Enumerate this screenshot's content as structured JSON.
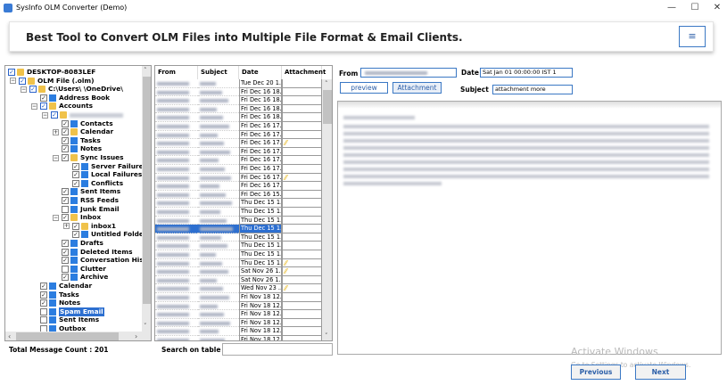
{
  "window": {
    "title": "SysInfo OLM Converter (Demo)",
    "min": "—",
    "max": "☐",
    "close": "✕"
  },
  "banner": {
    "heading": "Best Tool to Convert OLM Files into Multiple File Format & Email Clients.",
    "menu_icon": "≡"
  },
  "tree": {
    "items": [
      {
        "label": "DESKTOP-8083LEF",
        "level": 0,
        "checked": true,
        "blue": true,
        "icon": "folder",
        "exp": "-"
      },
      {
        "label": "OLM File (.olm)",
        "level": 1,
        "checked": true,
        "blue": true,
        "icon": "folder",
        "exp": "-"
      },
      {
        "label": "C:\\Users\\ \\OneDrive\\",
        "level": 2,
        "checked": true,
        "blue": true,
        "icon": "folder",
        "exp": "-"
      },
      {
        "label": "Address Book",
        "level": 3,
        "checked": true,
        "icon": "file"
      },
      {
        "label": "Accounts",
        "level": 3,
        "checked": true,
        "blue": true,
        "icon": "folder",
        "exp": "-"
      },
      {
        "label": "",
        "level": 4,
        "checked": true,
        "blue": true,
        "icon": "folder",
        "exp": "-",
        "blur": true
      },
      {
        "label": "Contacts",
        "level": 5,
        "checked": true,
        "icon": "file"
      },
      {
        "label": "Calendar",
        "level": 5,
        "checked": true,
        "icon": "folder",
        "exp": "+"
      },
      {
        "label": "Tasks",
        "level": 5,
        "checked": true,
        "icon": "file"
      },
      {
        "label": "Notes",
        "level": 5,
        "checked": true,
        "icon": "file"
      },
      {
        "label": "Sync Issues",
        "level": 5,
        "checked": true,
        "icon": "folder",
        "exp": "-"
      },
      {
        "label": "Server Failures",
        "level": 6,
        "checked": true,
        "icon": "file"
      },
      {
        "label": "Local Failures",
        "level": 6,
        "checked": true,
        "icon": "file"
      },
      {
        "label": "Conflicts",
        "level": 6,
        "checked": true,
        "icon": "file"
      },
      {
        "label": "Sent Items",
        "level": 5,
        "checked": true,
        "icon": "file"
      },
      {
        "label": "RSS Feeds",
        "level": 5,
        "checked": true,
        "icon": "file"
      },
      {
        "label": "Junk Email",
        "level": 5,
        "checked": false,
        "icon": "file"
      },
      {
        "label": "Inbox",
        "level": 5,
        "checked": true,
        "icon": "folder",
        "exp": "-"
      },
      {
        "label": "inbox1",
        "level": 6,
        "checked": true,
        "icon": "folder",
        "exp": "+"
      },
      {
        "label": "Untitled Folder",
        "level": 6,
        "checked": true,
        "icon": "file"
      },
      {
        "label": "Drafts",
        "level": 5,
        "checked": true,
        "icon": "file"
      },
      {
        "label": "Deleted Items",
        "level": 5,
        "checked": true,
        "icon": "file"
      },
      {
        "label": "Conversation Histo",
        "level": 5,
        "checked": true,
        "icon": "file"
      },
      {
        "label": "Clutter",
        "level": 5,
        "checked": false,
        "icon": "file"
      },
      {
        "label": "Archive",
        "level": 5,
        "checked": true,
        "icon": "file"
      },
      {
        "label": "Calendar",
        "level": 3,
        "checked": true,
        "icon": "file"
      },
      {
        "label": "Tasks",
        "level": 3,
        "checked": true,
        "icon": "file"
      },
      {
        "label": "Notes",
        "level": 3,
        "checked": true,
        "icon": "file"
      },
      {
        "label": "Spam Email",
        "level": 3,
        "checked": false,
        "icon": "file",
        "selected": true
      },
      {
        "label": "Sent Items",
        "level": 3,
        "checked": false,
        "icon": "file"
      },
      {
        "label": "Outbox",
        "level": 3,
        "checked": false,
        "icon": "file"
      }
    ]
  },
  "total_count": "Total Message Count : 201",
  "table": {
    "headers": [
      "From",
      "Subject",
      "Date",
      "Attachment"
    ],
    "rows": [
      {
        "date": "Tue Dec 20 1...",
        "att": false
      },
      {
        "date": "Fri Dec 16 18...",
        "att": false
      },
      {
        "date": "Fri Dec 16 18...",
        "att": false
      },
      {
        "date": "Fri Dec 16 18...",
        "att": false
      },
      {
        "date": "Fri Dec 16 18...",
        "att": false
      },
      {
        "date": "Fri Dec 16 17...",
        "att": false
      },
      {
        "date": "Fri Dec 16 17...",
        "att": false
      },
      {
        "date": "Fri Dec 16 17...",
        "att": true
      },
      {
        "date": "Fri Dec 16 17...",
        "att": false
      },
      {
        "date": "Fri Dec 16 17...",
        "att": false
      },
      {
        "date": "Fri Dec 16 17...",
        "att": false
      },
      {
        "date": "Fri Dec 16 17...",
        "att": true
      },
      {
        "date": "Fri Dec 16 17...",
        "att": false
      },
      {
        "date": "Fri Dec 16 15...",
        "att": false
      },
      {
        "date": "Thu Dec 15 1...",
        "att": false
      },
      {
        "date": "Thu Dec 15 1...",
        "att": false
      },
      {
        "date": "Thu Dec 15 1...",
        "att": false
      },
      {
        "date": "Thu Dec 15 1...",
        "att": false,
        "selected": true
      },
      {
        "date": "Thu Dec 15 1...",
        "att": false
      },
      {
        "date": "Thu Dec 15 1...",
        "att": false
      },
      {
        "date": "Thu Dec 15 1...",
        "att": false
      },
      {
        "date": "Thu Dec 15 1...",
        "att": true
      },
      {
        "date": "Sat Nov 26 1...",
        "att": true
      },
      {
        "date": "Sat Nov 26 1...",
        "att": false
      },
      {
        "date": "Wed Nov 23 ...",
        "att": true
      },
      {
        "date": "Fri Nov 18 12...",
        "att": false
      },
      {
        "date": "Fri Nov 18 12...",
        "att": false
      },
      {
        "date": "Fri Nov 18 12...",
        "att": false
      },
      {
        "date": "Fri Nov 18 12...",
        "att": false
      },
      {
        "date": "Fri Nov 18 12...",
        "att": false
      },
      {
        "date": "Fri Nov 18 12...",
        "att": false
      }
    ]
  },
  "search": {
    "label": "Search on table :",
    "value": ""
  },
  "preview": {
    "from_label": "From",
    "date_label": "Date",
    "date_value": "Sat Jan 01 00:00:00 IST 1",
    "subject_label": "Subject",
    "subject_value": "attachment more",
    "preview_btn": "preview",
    "attachment_btn": "Attachment"
  },
  "nav": {
    "previous": "Previous",
    "next": "Next"
  },
  "watermark": {
    "line1": "Activate Windows",
    "line2": "Go to Settings to activate Windows."
  }
}
